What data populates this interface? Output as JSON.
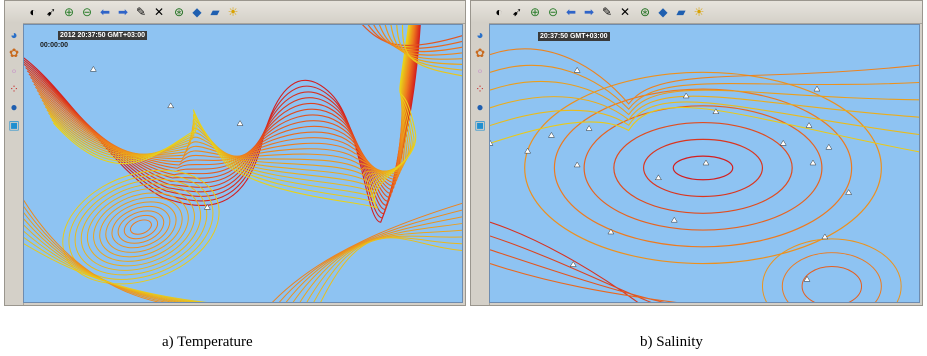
{
  "panels": [
    {
      "timestamp": "2012 20:37:50 GMT+03:00",
      "timestamp_secondary": "00:00:00",
      "caption": "a) Temperature"
    },
    {
      "timestamp": "20:37:50 GMT+03:00",
      "caption": "b) Salinity"
    }
  ],
  "toolbar_icons": [
    "home-icon",
    "pointer-icon",
    "zoom-in-icon",
    "zoom-out-icon",
    "back-arrow-icon",
    "forward-arrow-icon",
    "measure-icon",
    "clear-icon",
    "target-icon",
    "layers-icon",
    "export-icon",
    "refresh-icon"
  ],
  "side_icons": [
    "globe-icon",
    "palette-icon",
    "points-icon",
    "markers-icon",
    "earth-icon",
    "grid-icon"
  ],
  "colors": {
    "water": "#8ec3f2",
    "contour_warm": "#d41e1e",
    "contour_mid": "#ee7a1e",
    "contour_cool": "#e8d21a",
    "contour_light": "#c8e83a",
    "station": "#ffffff"
  }
}
